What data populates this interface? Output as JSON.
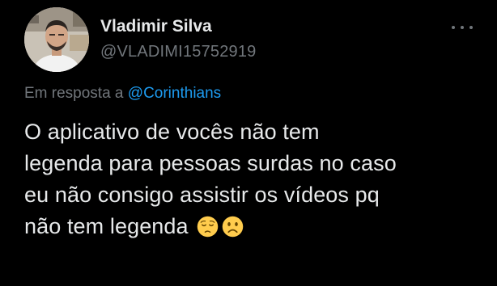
{
  "author": {
    "display_name": "Vladimir Silva",
    "handle": "@VLADIMI15752919",
    "avatar_icon": "profile-photo"
  },
  "menu": {
    "icon": "more-dots-icon"
  },
  "reply": {
    "prefix": "Em resposta a",
    "mention": "@Corinthians"
  },
  "tweet": {
    "lines": [
      "O aplicativo de vocês não tem",
      "legenda para pessoas surdas no caso",
      "eu não consigo assistir os vídeos pq",
      "não tem legenda"
    ],
    "emojis": [
      "pensive-face-emoji",
      "frowning-face-emoji"
    ]
  },
  "colors": {
    "background": "#000000",
    "text": "#e7e9ea",
    "secondary": "#71767b",
    "link": "#1d9bf0"
  }
}
